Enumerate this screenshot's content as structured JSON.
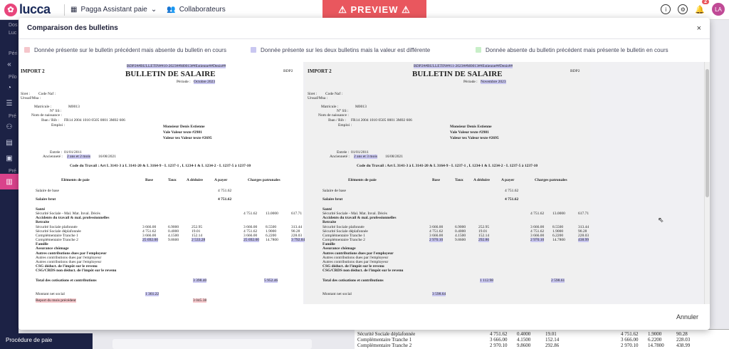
{
  "topbar": {
    "brand": "lucca",
    "app_name": "Pagga Assistant paie",
    "collab_label": "Collaborateurs",
    "preview": "⚠ PREVIEW ⚠",
    "notif_count": "2",
    "avatar": "LA"
  },
  "sidebar": {
    "labels": [
      "Dos",
      "Luc",
      "Péri",
      "Pilo",
      "Pré",
      "Pré"
    ],
    "procedure": "Procédure de paie"
  },
  "modal": {
    "title": "Comparaison des bulletins",
    "close": "×",
    "legend": [
      {
        "label": "Donnée présente sur le bulletin précédent mais absente du bulletin en cours",
        "color": "#f5c6cb"
      },
      {
        "label": "Donnée présente sur les deux bulletins mais la valeur est différente",
        "color": "#c9c7f1"
      },
      {
        "label": "Donnée absente du bulletin précédent mais présente le bulletin en cours",
        "color": "#c8efc8"
      }
    ],
    "cancel": "Annuler"
  },
  "payslips": [
    {
      "import": "IMPORT 2",
      "ref": "BDP2##BULLETIN##10-2023##M0013##Estienne##Denis##",
      "title": "BULLETIN DE SALAIRE",
      "code": "BDP2",
      "period_label": "Période :",
      "period": "Octobre 2023",
      "anciennete": "2 ans et 2 mois",
      "rows_values": [
        "4 751.62",
        "4 751.62",
        "",
        "4 751.62",
        "13.0000",
        "617.71",
        "3 666.00",
        "6.9000",
        "252.95",
        "3 666.00",
        "8.5500",
        "313.44",
        "4 751.62",
        "0.4000",
        "19.01",
        "4 751.62",
        "1.9000",
        "90.28",
        "3 666.00",
        "4.1500",
        "152.14",
        "3 666.00",
        "6.2200",
        "228.03",
        "25 692.00",
        "9.8600",
        "2 533.28",
        "25 692.00",
        "14.7800",
        "3 792.84"
      ],
      "total": "3 398.40",
      "total_patr": "5 952.46",
      "net_social": "1 361.22",
      "report": "3 045.38"
    },
    {
      "import": "IMPORT 2",
      "ref": "BDP2##BULLETIN##11-2023##M0013##Estienne##Denis##",
      "title": "BULLETIN DE SALAIRE",
      "code": "BDP2",
      "period_label": "Période :",
      "period": "Novembre 2023",
      "anciennete": "2 ans et 3 mois",
      "rows_values": [
        "4 751.62",
        "4 751.62",
        "",
        "4 751.62",
        "13.0000",
        "617.71",
        "3 666.00",
        "6.9000",
        "252.95",
        "3 666.00",
        "8.5500",
        "313.44",
        "4 751.62",
        "0.4000",
        "19.01",
        "4 751.62",
        "1.9000",
        "90.28",
        "3 666.00",
        "4.1500",
        "152.14",
        "3 666.00",
        "6.2200",
        "228.03",
        "2 970.10",
        "9.8600",
        "292.86",
        "2 970.10",
        "14.7800",
        "438.99"
      ],
      "total": "1 112.98",
      "total_patr": "2 598.61",
      "net_social": "3 598.64",
      "report": ""
    }
  ],
  "common": {
    "siret": "Siret :",
    "code_naf": "Code Naf :",
    "urssaf": "Urssaf/Msa :",
    "matricule_label": "Matricule :",
    "matricule": "M0013",
    "nss_label": "N° SS :",
    "naissance_label": "Nom de naissance :",
    "iban_label": "Iban / Rib :",
    "iban": "FR14 2004 1010 0505 0001 3M02 606",
    "emploi_label": "Emploi :",
    "name": "Monsieur Denis Estienne",
    "addr1": "Vale Valeur texte #2981",
    "addr2": "Valeur tex Valeur texte #2695",
    "entree_label": "Entrée :",
    "entree": "01/01/2011",
    "anciennete_label": "Ancienneté :",
    "anc_date": "16/08/2021",
    "code_travail": "Code du Travail : Art L 3141-3 à L 3141-20 & L 3164-9 - L 1237-1 , L 1234-1 & L 1234-2 - L 1237-5 à 1237-10",
    "h_elements": "Eléments de paie",
    "h_base": "Base",
    "h_taux": "Taux",
    "h_deduire": "A déduire",
    "h_payer": "A payer",
    "h_patr": "Charges patronales",
    "labels": [
      "Salaire de base",
      "Salaire brut",
      "Santé",
      "Sécurité Sociale - Mal. Mat. Inval. Décès",
      "Accidents du travail & mal. professionnelles",
      "Retraite",
      "Sécurité Sociale plafonnée",
      "Sécurité Sociale déplafonnée",
      "Complémentaire Tranche 1",
      "Complémentaire Tranche 2",
      "Famille",
      "Assurance chômage",
      "Autres contributions dues par l'employeur",
      "Autres contributions dues par l'employeur",
      "Autres contributions dues par l'employeur",
      "CSG déduct. de l'impôt sur le revenu",
      "CSG/CRDS non déduct. de l'impôt sur le revenu"
    ],
    "total_label": "Total des cotisations et contributions",
    "net_label": "Montant net social",
    "report_label": "Report du mois précédent"
  },
  "background": {
    "rows": [
      [
        "Sécurité Sociale déplafonnée",
        "4 751.62",
        "0.4000",
        "19.01",
        "4 751.62",
        "1.9000",
        "90.28"
      ],
      [
        "Complémentaire Tranche 1",
        "3 666.00",
        "4.1500",
        "152.14",
        "3 666.00",
        "6.2200",
        "228.03"
      ],
      [
        "Complémentaire Tranche 2",
        "2 970.10",
        "9.8600",
        "292.86",
        "2 970.10",
        "14.7800",
        "438.99"
      ]
    ]
  }
}
